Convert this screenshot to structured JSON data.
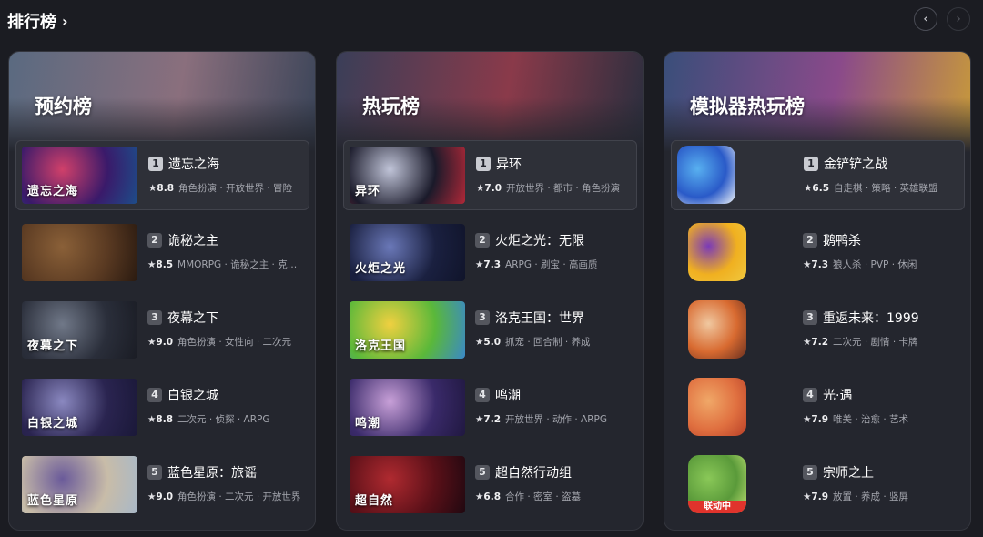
{
  "header": {
    "title": "排行榜"
  },
  "panels": [
    {
      "title": "预约榜",
      "banner": [
        "#5a6a80",
        "#8a6f7d",
        "#3a4458"
      ],
      "items": [
        {
          "rank": "1",
          "name": "遗忘之海",
          "score": "8.8",
          "tags": "角色扮演 · 开放世界 · 冒险",
          "thumb": [
            "#3a1a6a",
            "#d0406a",
            "#1d4d8a"
          ],
          "thumb_text": "遗忘之海"
        },
        {
          "rank": "2",
          "name": "诡秘之主",
          "score": "8.5",
          "tags": "MMORPG · 诡秘之主 · 克苏鲁",
          "thumb": [
            "#5a3a22",
            "#8a6038",
            "#2a1a10"
          ],
          "thumb_text": ""
        },
        {
          "rank": "3",
          "name": "夜幕之下",
          "score": "9.0",
          "tags": "角色扮演 · 女性向 · 二次元",
          "thumb": [
            "#2a2e3a",
            "#707888",
            "#1a1c24"
          ],
          "thumb_text": "夜幕之下"
        },
        {
          "rank": "4",
          "name": "白银之城",
          "score": "8.8",
          "tags": "二次元 · 侦探 · ARPG",
          "thumb": [
            "#2a2450",
            "#8a88c0",
            "#1a1838"
          ],
          "thumb_text": "白银之城"
        },
        {
          "rank": "5",
          "name": "蓝色星原：旅谣",
          "score": "9.0",
          "tags": "角色扮演 · 二次元 · 开放世界",
          "thumb": [
            "#c8bca8",
            "#6a5a9a",
            "#a8b8c8"
          ],
          "thumb_text": "蓝色星原"
        }
      ]
    },
    {
      "title": "热玩榜",
      "banner": [
        "#3a3e58",
        "#8a3a4a",
        "#2a2e3e"
      ],
      "items": [
        {
          "rank": "1",
          "name": "异环",
          "score": "7.0",
          "tags": "开放世界 · 都市 · 角色扮演",
          "thumb": [
            "#1a1a2a",
            "#c0c4d8",
            "#b02838"
          ],
          "thumb_text": "异环"
        },
        {
          "rank": "2",
          "name": "火炬之光：无限",
          "score": "7.3",
          "tags": "ARPG · 刷宝 · 高画质",
          "thumb": [
            "#1a2040",
            "#6a78b8",
            "#10142a"
          ],
          "thumb_text": "火炬之光"
        },
        {
          "rank": "3",
          "name": "洛克王国：世界",
          "score": "5.0",
          "tags": "抓宠 · 回合制 · 养成",
          "thumb": [
            "#5ab83a",
            "#f0d040",
            "#3a88c8"
          ],
          "thumb_text": "洛克王国"
        },
        {
          "rank": "4",
          "name": "鸣潮",
          "score": "7.2",
          "tags": "开放世界 · 动作 · ARPG",
          "thumb": [
            "#3a2a6a",
            "#c8a0d8",
            "#201840"
          ],
          "thumb_text": "鸣潮"
        },
        {
          "rank": "5",
          "name": "超自然行动组",
          "score": "6.8",
          "tags": "合作 · 密室 · 盗墓",
          "thumb": [
            "#5a1018",
            "#b02a30",
            "#200810"
          ],
          "thumb_text": "超自然"
        }
      ]
    },
    {
      "title": "模拟器热玩榜",
      "banner": [
        "#3a4e7a",
        "#8a4a8a",
        "#c89a3a"
      ],
      "items": [
        {
          "rank": "1",
          "name": "金铲铲之战",
          "score": "6.5",
          "tags": "自走棋 · 策略 · 英雄联盟",
          "thumb": [
            "#2a5ac8",
            "#58b0f0",
            "#f0f4f8"
          ],
          "badge": ""
        },
        {
          "rank": "2",
          "name": "鹅鸭杀",
          "score": "7.3",
          "tags": "狼人杀 · PVP · 休闲",
          "thumb": [
            "#f0b020",
            "#7a3ab8",
            "#f0c840"
          ],
          "badge": ""
        },
        {
          "rank": "3",
          "name": "重返未来：1999",
          "score": "7.2",
          "tags": "二次元 · 剧情 · 卡牌",
          "thumb": [
            "#d86a30",
            "#f0c8a0",
            "#6a3020"
          ],
          "badge": ""
        },
        {
          "rank": "4",
          "name": "光·遇",
          "score": "7.9",
          "tags": "唯美 · 治愈 · 艺术",
          "thumb": [
            "#e07040",
            "#f0a868",
            "#b84028"
          ],
          "badge": ""
        },
        {
          "rank": "5",
          "name": "宗师之上",
          "score": "7.9",
          "tags": "放置 · 养成 · 竖屏",
          "thumb": [
            "#5a9a3a",
            "#8ac858",
            "#c8e878"
          ],
          "badge": "联动中"
        }
      ]
    }
  ]
}
